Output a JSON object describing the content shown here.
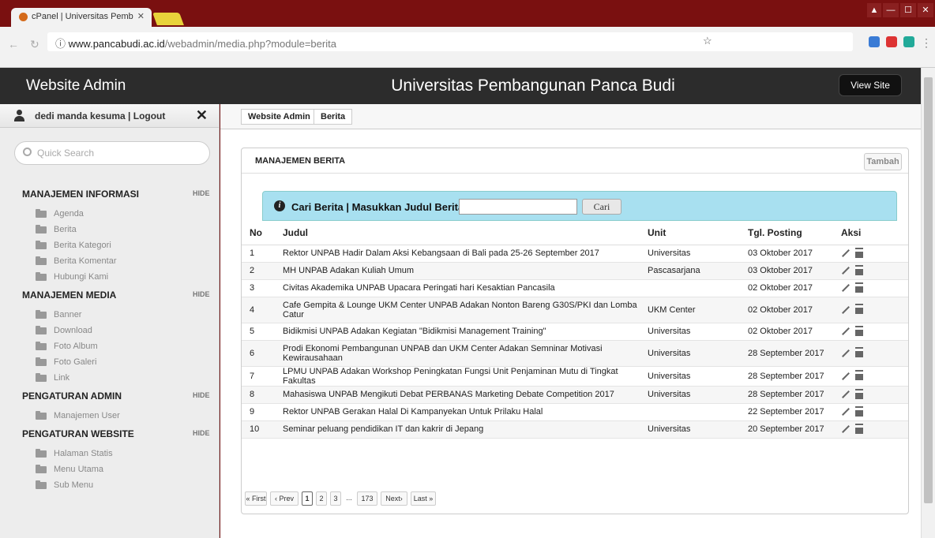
{
  "browser": {
    "tab_title": "cPanel | Universitas Pemb",
    "url_host": "www.pancabudi.ac.id",
    "url_path": "/webadmin/media.php?module=berita"
  },
  "header": {
    "app_title": "Website Admin",
    "site_name": "Universitas Pembangunan Panca Budi",
    "view_site": "View Site"
  },
  "sidebar": {
    "user": "dedi manda kesuma | Logout",
    "search_placeholder": "Quick Search",
    "hide": "HIDE",
    "sections": [
      {
        "title": "MANAJEMEN INFORMASI",
        "items": [
          "Agenda",
          "Berita",
          "Berita Kategori",
          "Berita Komentar",
          "Hubungi Kami"
        ]
      },
      {
        "title": "MANAJEMEN MEDIA",
        "items": [
          "Banner",
          "Download",
          "Foto Album",
          "Foto Galeri",
          "Link"
        ]
      },
      {
        "title": "PENGATURAN ADMIN",
        "items": [
          "Manajemen User"
        ]
      },
      {
        "title": "PENGATURAN WEBSITE",
        "items": [
          "Halaman Statis",
          "Menu Utama",
          "Sub Menu"
        ]
      }
    ]
  },
  "breadcrumb": [
    "Website Admin",
    "Berita"
  ],
  "panel": {
    "title": "MANAJEMEN BERITA",
    "add_button": "Tambah",
    "search_label": "Cari Berita | Masukkan Judul Berita :",
    "search_value": "",
    "search_button": "Cari"
  },
  "table": {
    "headers": [
      "No",
      "Judul",
      "Unit",
      "Tgl. Posting",
      "Aksi"
    ],
    "rows": [
      [
        "1",
        "Rektor UNPAB Hadir Dalam Aksi Kebangsaan di Bali pada 25-26 September 2017",
        "Universitas",
        "03 Oktober 2017"
      ],
      [
        "2",
        "MH UNPAB Adakan Kuliah Umum",
        "Pascasarjana",
        "03 Oktober 2017"
      ],
      [
        "3",
        "Civitas Akademika UNPAB Upacara Peringati hari Kesaktian Pancasila",
        "",
        "02 Oktober 2017"
      ],
      [
        "4",
        "Cafe Gempita & Lounge UKM Center UNPAB Adakan Nonton Bareng G30S/PKI dan Lomba Catur",
        "UKM Center",
        "02 Oktober 2017"
      ],
      [
        "5",
        "Bidikmisi UNPAB Adakan Kegiatan \"Bidikmisi Management Training\"",
        "Universitas",
        "02 Oktober 2017"
      ],
      [
        "6",
        "Prodi Ekonomi Pembangunan UNPAB dan UKM Center Adakan Semninar Motivasi Kewirausahaan",
        "Universitas",
        "28 September 2017"
      ],
      [
        "7",
        "LPMU UNPAB Adakan Workshop Peningkatan Fungsi Unit Penjaminan Mutu di Tingkat Fakultas",
        "Universitas",
        "28 September 2017"
      ],
      [
        "8",
        "Mahasiswa UNPAB Mengikuti Debat PERBANAS Marketing Debate Competition 2017",
        "Universitas",
        "28 September 2017"
      ],
      [
        "9",
        "Rektor UNPAB Gerakan Halal Di Kampanyekan Untuk Prilaku Halal",
        "",
        "22 September 2017"
      ],
      [
        "10",
        "Seminar peluang pendidikan IT dan kakrir di Jepang",
        "Universitas",
        "20 September 2017"
      ]
    ]
  },
  "pagination": [
    "« First",
    "‹ Prev",
    "1",
    "2",
    "3",
    "...",
    "173",
    "Next›",
    "Last »"
  ],
  "pagination_current": "1"
}
